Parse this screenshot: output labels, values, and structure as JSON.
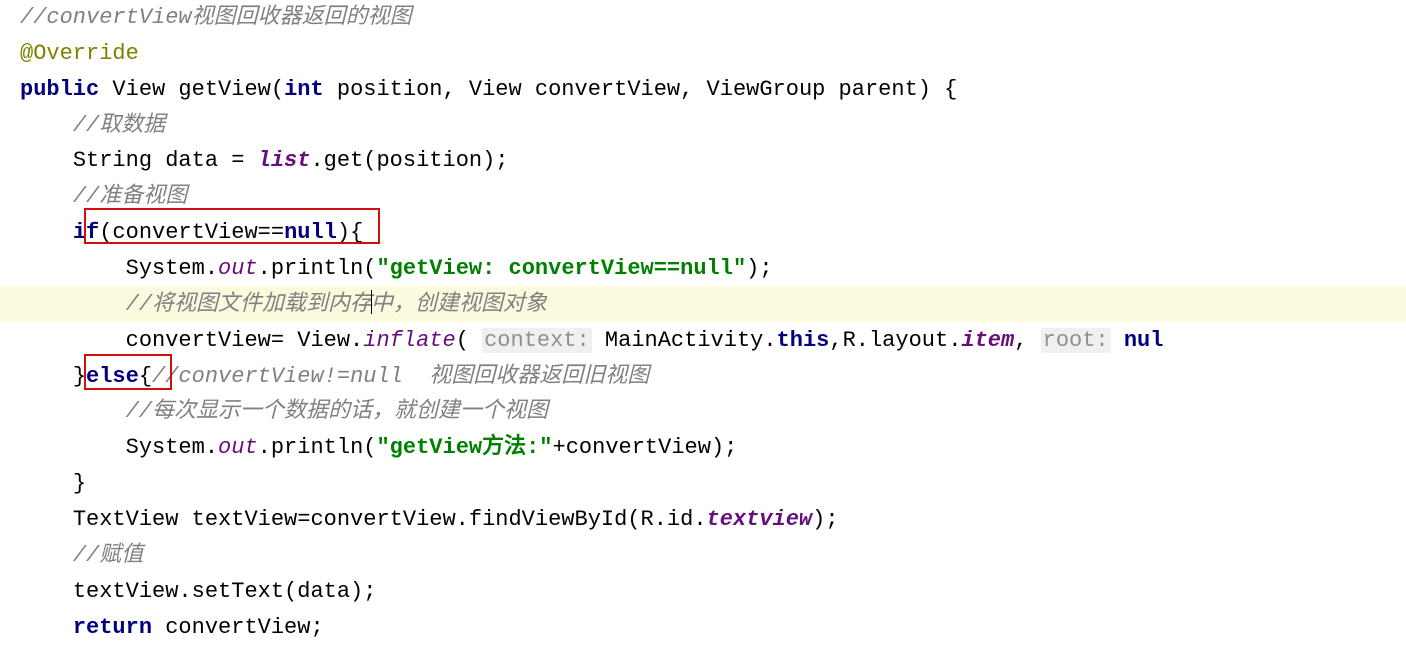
{
  "code": {
    "line1_comment": "//convertView视图回收器返回的视图",
    "line2_annotation": "@Override",
    "line3_public": "public",
    "line3_sig1": " View getView(",
    "line3_int": "int",
    "line3_sig2": " position, View convertView, ViewGroup parent) {",
    "line4_comment": "//取数据",
    "line5_text1": "String data = ",
    "line5_list": "list",
    "line5_text2": ".get(position);",
    "line6_comment": "//准备视图",
    "line7_if": "if",
    "line7_text1": "(convertView==",
    "line7_null": "null",
    "line7_text2": "){",
    "line8_text1": "System.",
    "line8_out": "out",
    "line8_text2": ".println(",
    "line8_string": "\"getView: convertView==null\"",
    "line8_text3": ");",
    "line9_comment_a": "//将视图文件加载到内存",
    "line9_comment_b": "中，创建视图对象",
    "line10_text1": "convertView= View.",
    "line10_inflate": "inflate",
    "line10_text2": "( ",
    "line10_hint1": "context:",
    "line10_text3": " MainActivity.",
    "line10_this": "this",
    "line10_text4": ",R.layout.",
    "line10_item": "item",
    "line10_text5": ", ",
    "line10_hint2": "root:",
    "line10_text6": " ",
    "line10_nul": "nul",
    "line11_text1": "}",
    "line11_else": "else",
    "line11_text2": "{",
    "line11_comment": "//convertView!=null  视图回收器返回旧视图",
    "line12_comment": "//每次显示一个数据的话，就创建一个视图",
    "line13_text1": "System.",
    "line13_out": "out",
    "line13_text2": ".println(",
    "line13_string": "\"getView方法:\"",
    "line13_text3": "+convertView);",
    "line14_text": "}",
    "line15_text1": "TextView textView=convertView.findViewById(R.id.",
    "line15_textview": "textview",
    "line15_text2": ");",
    "line16_comment": "//赋值",
    "line17_text": "textView.setText(data);",
    "line18_return": "return",
    "line18_text": " convertView;"
  }
}
